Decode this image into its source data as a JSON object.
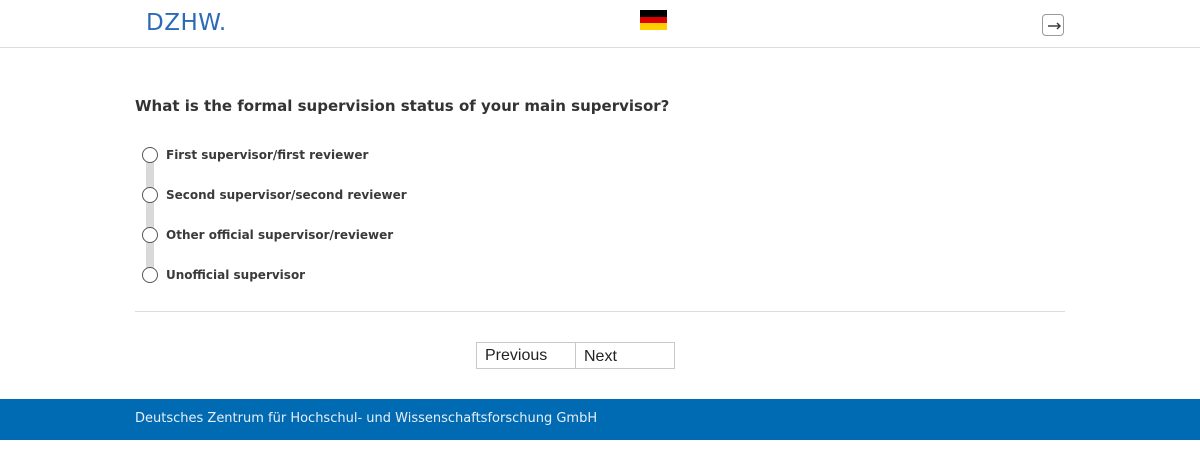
{
  "header": {
    "logo_text": "DZHW.",
    "flag_colors": [
      "#000000",
      "#dd0000",
      "#ffce00"
    ],
    "language_icon": "german-flag-icon",
    "logout_icon": "logout-icon"
  },
  "question": {
    "text": "What is the formal supervision status of your main supervisor?",
    "options": [
      {
        "label": "First supervisor/first reviewer"
      },
      {
        "label": "Second supervisor/second reviewer"
      },
      {
        "label": "Other official supervisor/reviewer"
      },
      {
        "label": "Unofficial supervisor"
      }
    ]
  },
  "navigation": {
    "previous_label": "Previous",
    "next_label": "Next"
  },
  "footer": {
    "text": "Deutsches Zentrum für Hochschul- und Wissenschaftsforschung GmbH",
    "color": "#006ab3"
  }
}
